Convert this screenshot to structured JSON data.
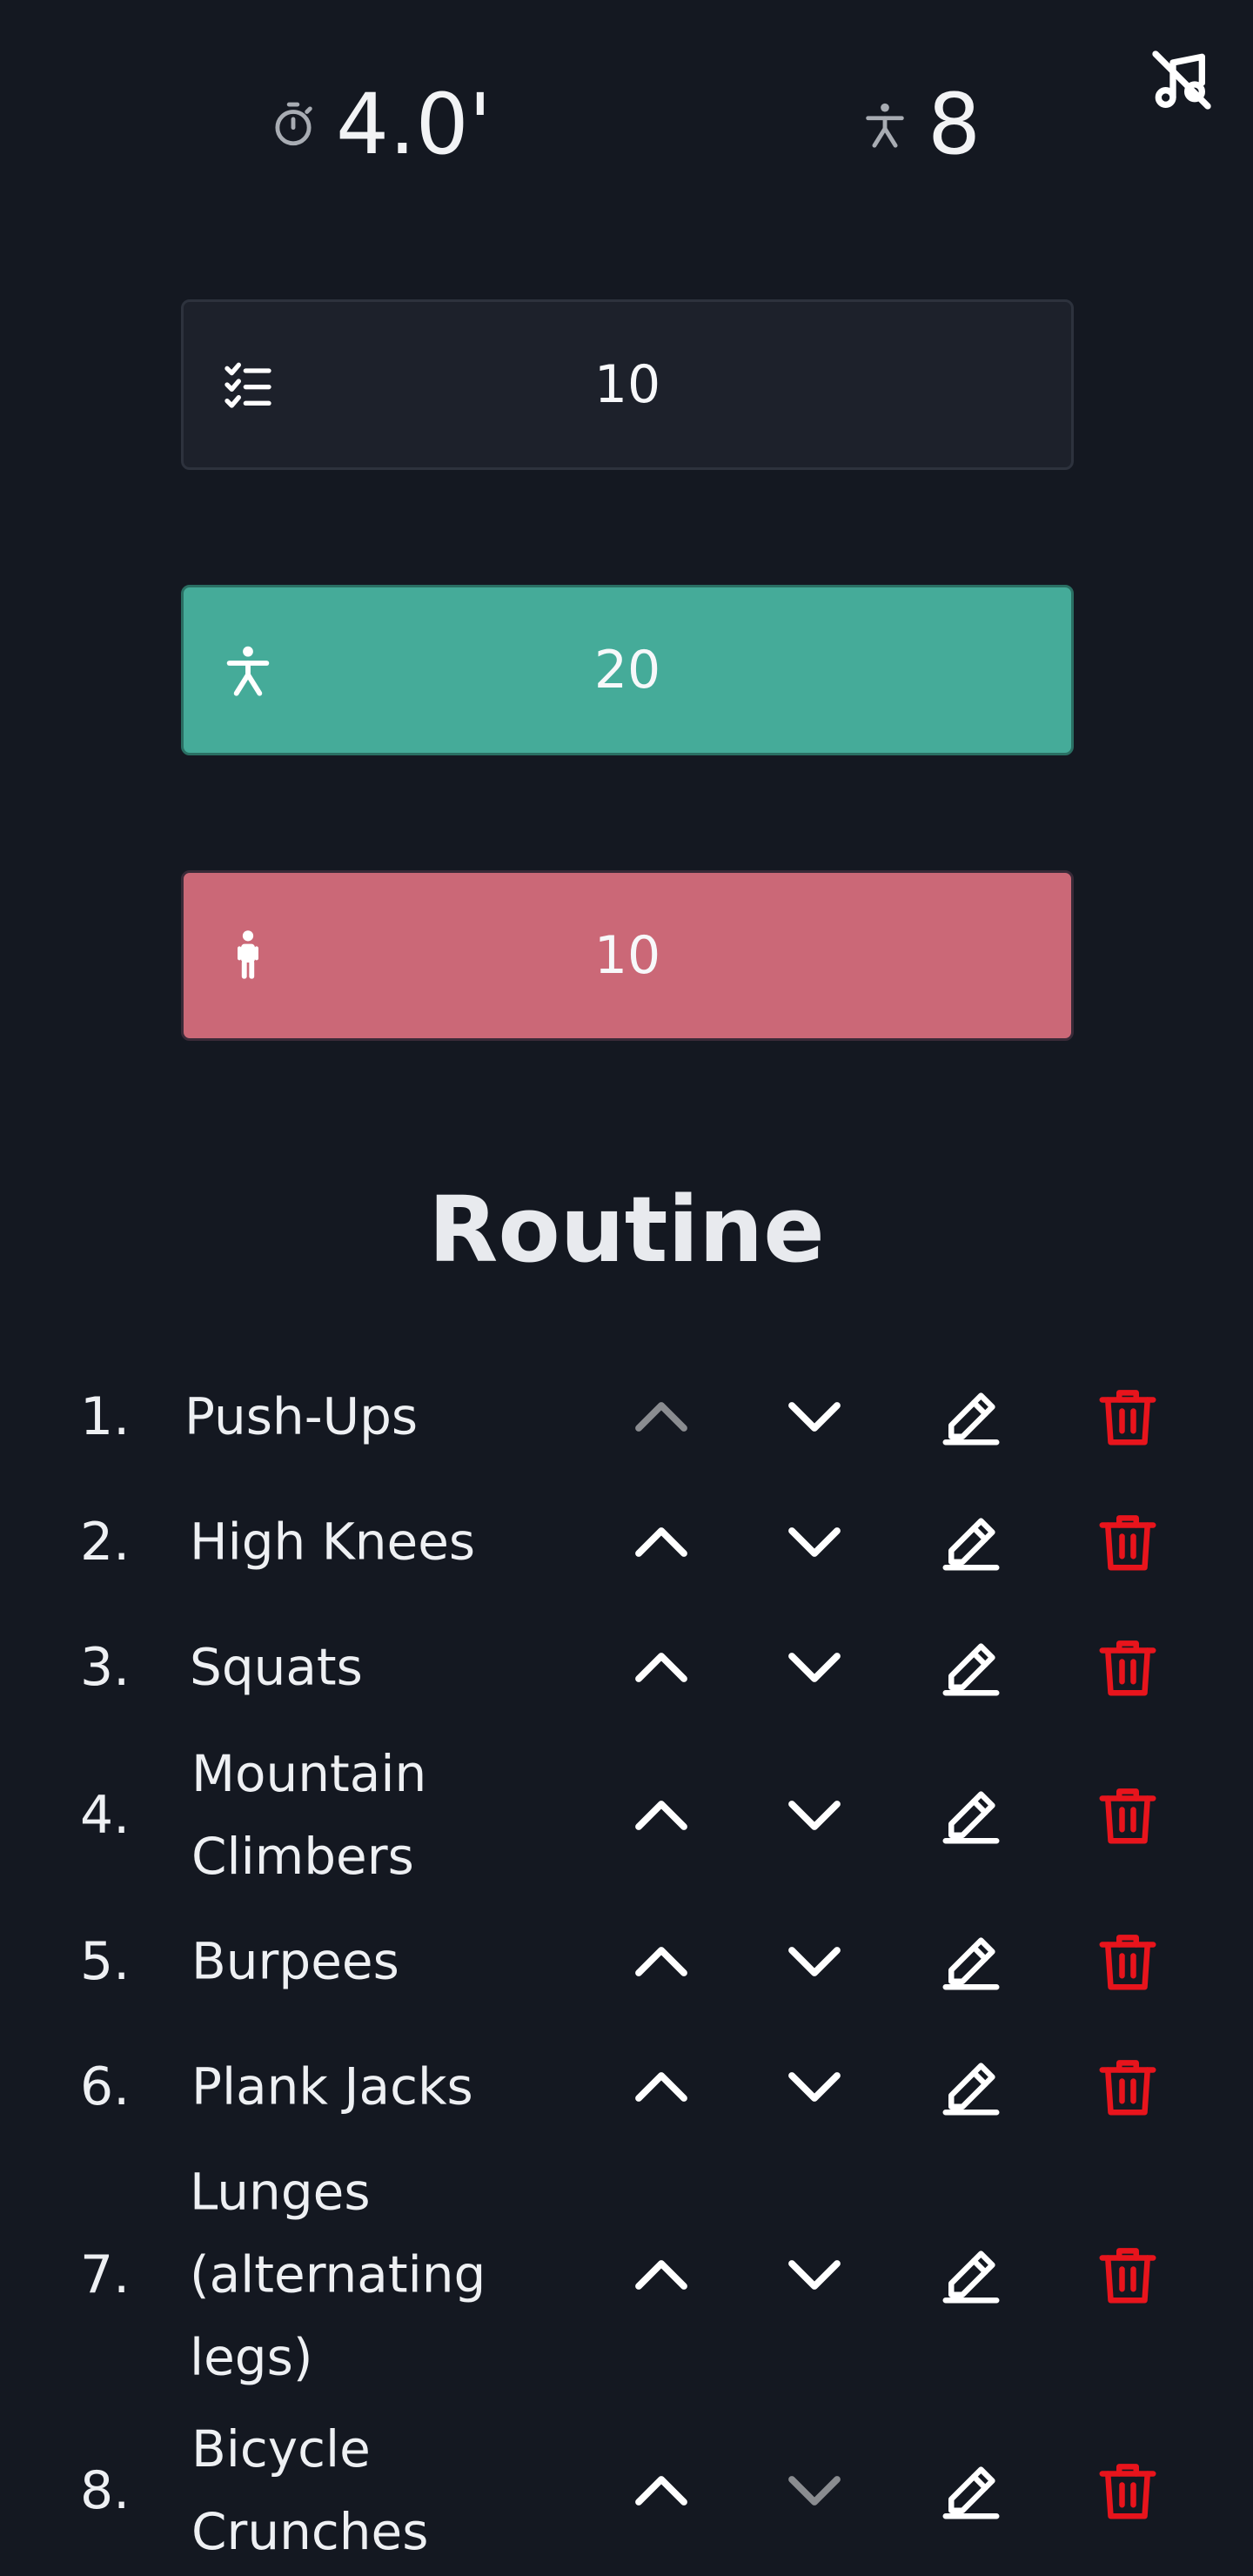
{
  "header": {
    "time_value": "4.0'",
    "time_icon": "stopwatch-icon",
    "people_value": "8",
    "people_icon": "person-icon",
    "mute_icon": "sound-off-icon"
  },
  "settings": [
    {
      "name": "exercise-count",
      "icon": "checklist-icon",
      "value": "10",
      "color": "#1d212b"
    },
    {
      "name": "work-seconds",
      "icon": "person-active-icon",
      "value": "20",
      "color": "#45ab99"
    },
    {
      "name": "rest-seconds",
      "icon": "person-standing-icon",
      "value": "10",
      "color": "#cb6877"
    }
  ],
  "routine": {
    "title": "Routine",
    "items": [
      {
        "number": "1.",
        "name": "Push-Ups",
        "up_disabled": true,
        "down_disabled": false
      },
      {
        "number": "2.",
        "name": "High Knees",
        "up_disabled": false,
        "down_disabled": false
      },
      {
        "number": "3.",
        "name": "Squats",
        "up_disabled": false,
        "down_disabled": false
      },
      {
        "number": "4.",
        "name": "Mountain Climbers",
        "up_disabled": false,
        "down_disabled": false
      },
      {
        "number": "5.",
        "name": "Burpees",
        "up_disabled": false,
        "down_disabled": false
      },
      {
        "number": "6.",
        "name": "Plank Jacks",
        "up_disabled": false,
        "down_disabled": false
      },
      {
        "number": "7.",
        "name": "Lunges (alternating legs)",
        "up_disabled": false,
        "down_disabled": false
      },
      {
        "number": "8.",
        "name": "Bicycle Crunches",
        "up_disabled": false,
        "down_disabled": true
      }
    ]
  },
  "colors": {
    "background": "#141821",
    "accent_work": "#45ab99",
    "accent_rest": "#cb6877",
    "delete": "#e8141c"
  }
}
